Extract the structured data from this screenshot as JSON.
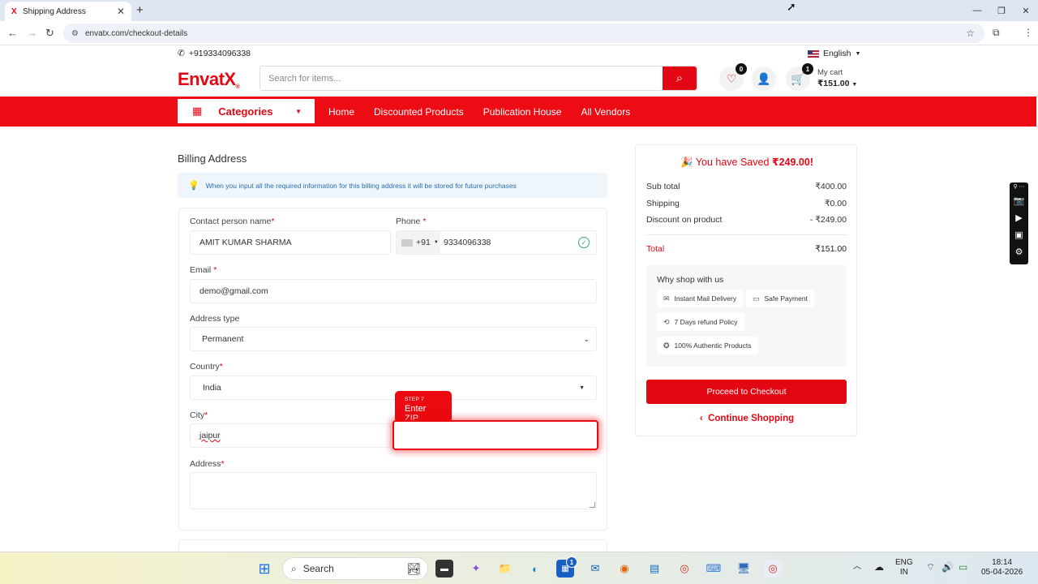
{
  "browser": {
    "tab_title": "Shipping Address",
    "tab_favicon": "X",
    "url": "envatx.com/checkout-details"
  },
  "topbar": {
    "phone": "+919334096338",
    "language": "English"
  },
  "header": {
    "logo_text": "EnvatX",
    "logo_reg": "®",
    "search_placeholder": "Search for items...",
    "wishlist_count": "0",
    "cart_count": "1",
    "cart_label": "My cart",
    "cart_total": "₹151.00"
  },
  "nav": {
    "categories_label": "Categories",
    "items": [
      "Home",
      "Discounted Products",
      "Publication House",
      "All Vendors"
    ]
  },
  "billing": {
    "title": "Billing Address",
    "note": "When you input all the required information for this billing address it will be stored for future purchases",
    "contact_label": "Contact person name",
    "contact_value": "AMIT KUMAR SHARMA",
    "phone_label": "Phone",
    "phone_code": "+91",
    "phone_value": "9334096338",
    "email_label": "Email",
    "email_value": "demo@gmail.com",
    "address_type_label": "Address type",
    "address_type_value": "Permanent",
    "country_label": "Country",
    "country_value": "India",
    "city_label": "City",
    "city_value": "jaipur",
    "address_label": "Address",
    "required_mark": "*"
  },
  "tour": {
    "step": "STEP 7",
    "text": "Enter ZIP"
  },
  "summary": {
    "saved_prefix": "You have Saved",
    "saved_amount": "₹249.00!",
    "subtotal_label": "Sub total",
    "subtotal_value": "₹400.00",
    "shipping_label": "Shipping",
    "shipping_value": "₹0.00",
    "discount_label": "Discount on product",
    "discount_value": "- ₹249.00",
    "total_label": "Total",
    "total_value": "₹151.00",
    "why_title": "Why shop with us",
    "perks": [
      "Instant Mail Delivery",
      "Safe Payment",
      "7 Days refund Policy",
      "100% Authentic Products"
    ],
    "proceed_label": "Proceed to Checkout",
    "continue_label": "Continue Shopping"
  },
  "taskbar": {
    "search_label": "Search",
    "lang_line1": "ENG",
    "lang_line2": "IN",
    "time": "18:14",
    "date": "05-04-2026",
    "badge_count": "1"
  },
  "colors": {
    "brand_red": "#e30613",
    "nav_red": "#ed0b14",
    "info_blue": "#2a6fb0",
    "check_green": "#3aa76d"
  }
}
